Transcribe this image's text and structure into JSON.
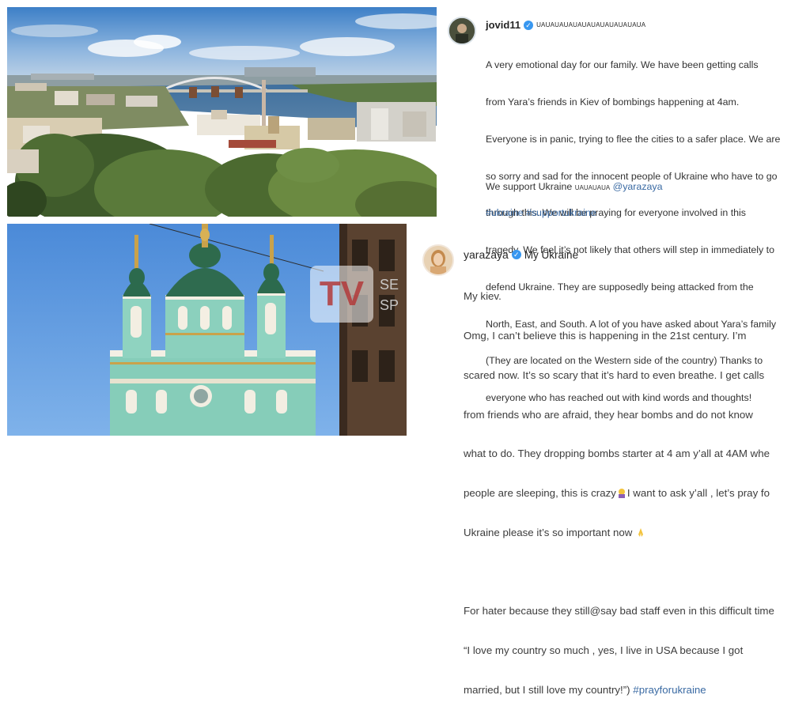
{
  "post1": {
    "username": "jovid11",
    "name_suffix": "UAUAUAUAUAUAUAUAUAUAUAUA",
    "caption_lines": [
      "A very emotional day for our family. We have been getting calls",
      "from Yara’s friends in Kiev of bombings happening at 4am.",
      "Everyone is in panic, trying to flee the cities to a safer place. We are",
      "so sorry and sad for the innocent people of Ukraine who have to go",
      "through this. We will be praying for everyone involved in this",
      "tragedy. We feel it’s not likely that others will step in immediately to",
      "defend Ukraine. They are supposedly being attacked from the",
      "North, East, and South. A lot of you have asked about Yara’s family",
      "(They are located on the Western side of the country) Thanks to",
      "everyone who has reached out with kind words and thoughts!"
    ],
    "support_text": "We support Ukraine",
    "support_flags": "UAUAUAUA",
    "mention": "@yarazaya",
    "hashtags": "#ukraine #supportukraine"
  },
  "post2": {
    "username": "yarazaya",
    "name_suffix": "My Ukraine",
    "lines": [
      {
        "text": "My kiev."
      },
      {
        "text": "Omg, I can’t believe this is happening in the 21st century. I’m"
      },
      {
        "text": "scared now. It’s so scary that it’s hard to even breathe. I get calls"
      },
      {
        "text": "from friends who are afraid, they hear bombs and do not know"
      },
      {
        "text": "what to do. They dropping bombs starter at 4 am y’all at 4AM whe"
      },
      {
        "text": "people are sleeping, this is crazy",
        "after": "I want to ask y’all , let’s pray fo"
      },
      {
        "text": "Ukraine please it’s so important now"
      },
      {
        "text": ""
      },
      {
        "text": "For hater because they still@say bad staff even in this difficult time"
      },
      {
        "text": "“I love my country so much , yes, I live in USA because I got"
      },
      {
        "text": "married, but I still love my country!”)",
        "hashtag": "#prayforukraine"
      }
    ]
  },
  "watermark": {
    "logo": "TV",
    "side_text": "SE SP"
  },
  "colors": {
    "link": "#3a6aa3",
    "verified": "#3897f0",
    "sky_top": "#4d8fd6",
    "church_mint": "#7fc9b8"
  }
}
